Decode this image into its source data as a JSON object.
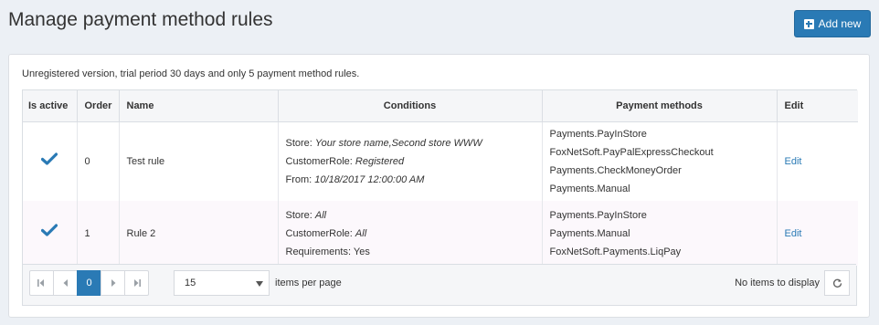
{
  "header": {
    "title": "Manage payment method rules",
    "add_new_label": "Add new"
  },
  "notice": "Unregistered version, trial period 30 days and only 5 payment method rules.",
  "table": {
    "columns": [
      "Is active",
      "Order",
      "Name",
      "Conditions",
      "Payment methods",
      "Edit"
    ],
    "rows": [
      {
        "is_active": true,
        "order": "0",
        "name": "Test rule",
        "conditions": [
          {
            "key": "Store: ",
            "value": "Your store name,Second store WWW"
          },
          {
            "key": "CustomerRole: ",
            "value": "Registered"
          },
          {
            "key": "From: ",
            "value": "10/18/2017 12:00:00 AM"
          }
        ],
        "payment_methods": [
          "Payments.PayInStore",
          "FoxNetSoft.PayPalExpressCheckout",
          "Payments.CheckMoneyOrder",
          "Payments.Manual"
        ],
        "edit": "Edit"
      },
      {
        "is_active": true,
        "order": "1",
        "name": "Rule 2",
        "conditions": [
          {
            "key": "Store: ",
            "value": "All"
          },
          {
            "key": "CustomerRole: ",
            "value": "All"
          },
          {
            "key": "Requirements: Yes",
            "value": ""
          }
        ],
        "payment_methods": [
          "Payments.PayInStore",
          "Payments.Manual",
          "FoxNetSoft.Payments.LiqPay"
        ],
        "edit": "Edit"
      }
    ]
  },
  "pager": {
    "current_page": "0",
    "page_size": "15",
    "items_per_page_label": "items per page",
    "status": "No items to display"
  },
  "colors": {
    "accent": "#2a7ab5",
    "check": "#2a7ab5"
  }
}
